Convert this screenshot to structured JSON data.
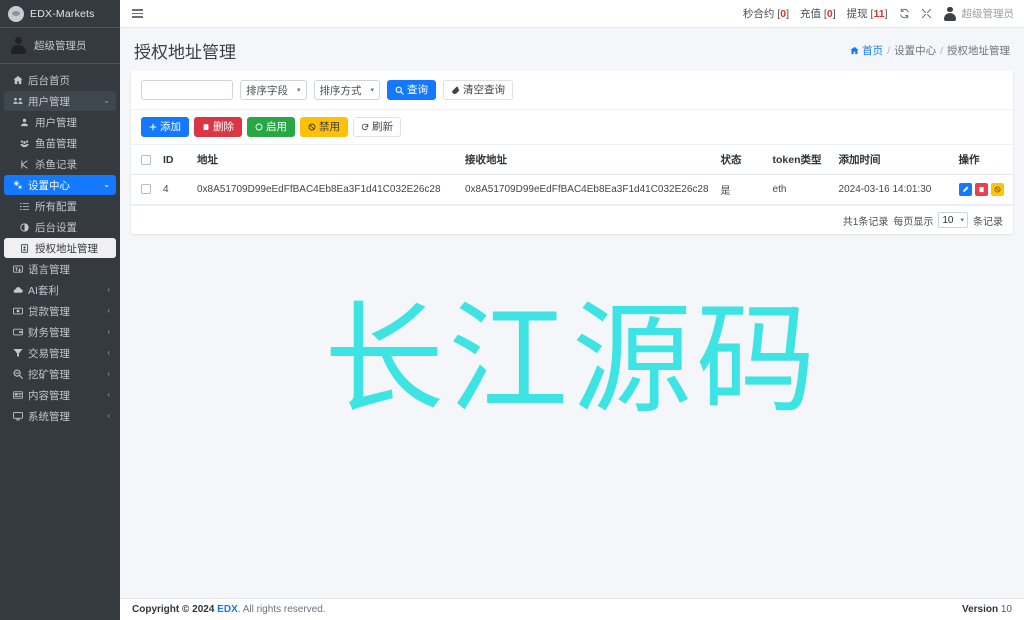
{
  "brand": {
    "title": "EDX-Markets",
    "logo_icon": "circle-logo-icon"
  },
  "sidebar": {
    "user": {
      "name": "超级管理员",
      "avatar_icon": "user-avatar-icon"
    },
    "items": [
      {
        "label": "后台首页",
        "icon": "home-icon",
        "state": "normal",
        "indent": false,
        "caret": ""
      },
      {
        "label": "用户管理",
        "icon": "users-icon",
        "state": "open-dark",
        "indent": false,
        "caret": "⌄"
      },
      {
        "label": "用户管理",
        "icon": "user-icon",
        "state": "normal",
        "indent": true,
        "caret": ""
      },
      {
        "label": "鱼苗管理",
        "icon": "users-group-icon",
        "state": "normal",
        "indent": true,
        "caret": ""
      },
      {
        "label": "杀鱼记录",
        "icon": "cut-icon",
        "state": "normal",
        "indent": true,
        "caret": ""
      },
      {
        "label": "设置中心",
        "icon": "gears-icon",
        "state": "active-blue",
        "indent": false,
        "caret": "⌄"
      },
      {
        "label": "所有配置",
        "icon": "list-icon",
        "state": "normal",
        "indent": true,
        "caret": ""
      },
      {
        "label": "后台设置",
        "icon": "contrast-icon",
        "state": "normal",
        "indent": true,
        "caret": ""
      },
      {
        "label": "授权地址管理",
        "icon": "address-book-icon",
        "state": "active-light",
        "indent": true,
        "caret": ""
      },
      {
        "label": "语言管理",
        "icon": "language-icon",
        "state": "normal",
        "indent": false,
        "caret": ""
      },
      {
        "label": "AI套利",
        "icon": "cloud-icon",
        "state": "normal",
        "indent": false,
        "caret": "‹"
      },
      {
        "label": "贷款管理",
        "icon": "money-icon",
        "state": "normal",
        "indent": false,
        "caret": "‹"
      },
      {
        "label": "财务管理",
        "icon": "wallet-icon",
        "state": "normal",
        "indent": false,
        "caret": "‹"
      },
      {
        "label": "交易管理",
        "icon": "funnel-icon",
        "state": "normal",
        "indent": false,
        "caret": "‹"
      },
      {
        "label": "挖矿管理",
        "icon": "search-minus-icon",
        "state": "normal",
        "indent": false,
        "caret": "‹"
      },
      {
        "label": "内容管理",
        "icon": "newspaper-icon",
        "state": "normal",
        "indent": false,
        "caret": "‹"
      },
      {
        "label": "系统管理",
        "icon": "desktop-icon",
        "state": "normal",
        "indent": false,
        "caret": "‹"
      }
    ]
  },
  "topbar": {
    "menu_icon": "hamburger-icon",
    "stats": [
      {
        "label": "秒合约",
        "count": "0"
      },
      {
        "label": "充值",
        "count": "0"
      },
      {
        "label": "提现",
        "count": "11"
      }
    ],
    "refresh_icon": "refresh-icon",
    "fullscreen_icon": "expand-icon",
    "user_name": "超级管理员",
    "user_avatar_icon": "user-avatar-icon"
  },
  "page": {
    "title": "授权地址管理",
    "breadcrumb": {
      "home_icon": "home-icon",
      "items": [
        "首页",
        "设置中心",
        "授权地址管理"
      ],
      "separator": "/"
    }
  },
  "search": {
    "input_value": "",
    "input_placeholder": "",
    "sort_field": {
      "label": "排序字段",
      "caret": "▾"
    },
    "sort_order": {
      "label": "排序方式",
      "caret": "▾"
    },
    "query_button": {
      "label": "查询",
      "icon": "search-icon"
    },
    "reset_button": {
      "label": "清空查询",
      "icon": "eraser-icon"
    }
  },
  "toolbar": {
    "buttons": [
      {
        "label": "添加",
        "icon": "plus-icon",
        "style": "btn-primary"
      },
      {
        "label": "删除",
        "icon": "trash-icon",
        "style": "btn-danger"
      },
      {
        "label": "启用",
        "icon": "circle-icon",
        "style": "btn-success"
      },
      {
        "label": "禁用",
        "icon": "ban-icon",
        "style": "btn-warning"
      },
      {
        "label": "刷新",
        "icon": "refresh-icon",
        "style": "btn-light"
      }
    ]
  },
  "table": {
    "columns": [
      "",
      "ID",
      "地址",
      "接收地址",
      "状态",
      "token类型",
      "添加时间",
      "操作"
    ],
    "rows": [
      {
        "id": "4",
        "address": "0x8A51709D99eEdFfBAC4Eb8Ea3F1d41C032E26c28",
        "receive_address": "0x8A51709D99eEdFfBAC4Eb8Ea3F1d41C032E26c28",
        "status": "是",
        "token_type": "eth",
        "created_at": "2024-03-16 14:01:30",
        "actions": [
          {
            "name": "edit-action",
            "icon": "pencil-icon"
          },
          {
            "name": "delete-action",
            "icon": "trash-icon"
          },
          {
            "name": "ban-action",
            "icon": "ban-icon"
          }
        ]
      }
    ],
    "footer": {
      "total_text": "共1条记录",
      "per_page_label": "每页显示",
      "per_page_value": "10",
      "per_page_caret": "▾",
      "records_suffix": "条记录"
    }
  },
  "watermark": {
    "text": "长江源码",
    "color": "#2fe3e3"
  },
  "footer": {
    "copyright_prefix": "Copyright © 2024",
    "brand": "EDX",
    "copyright_suffix": ". All rights reserved.",
    "version_label": "Version",
    "version_value": "10"
  }
}
